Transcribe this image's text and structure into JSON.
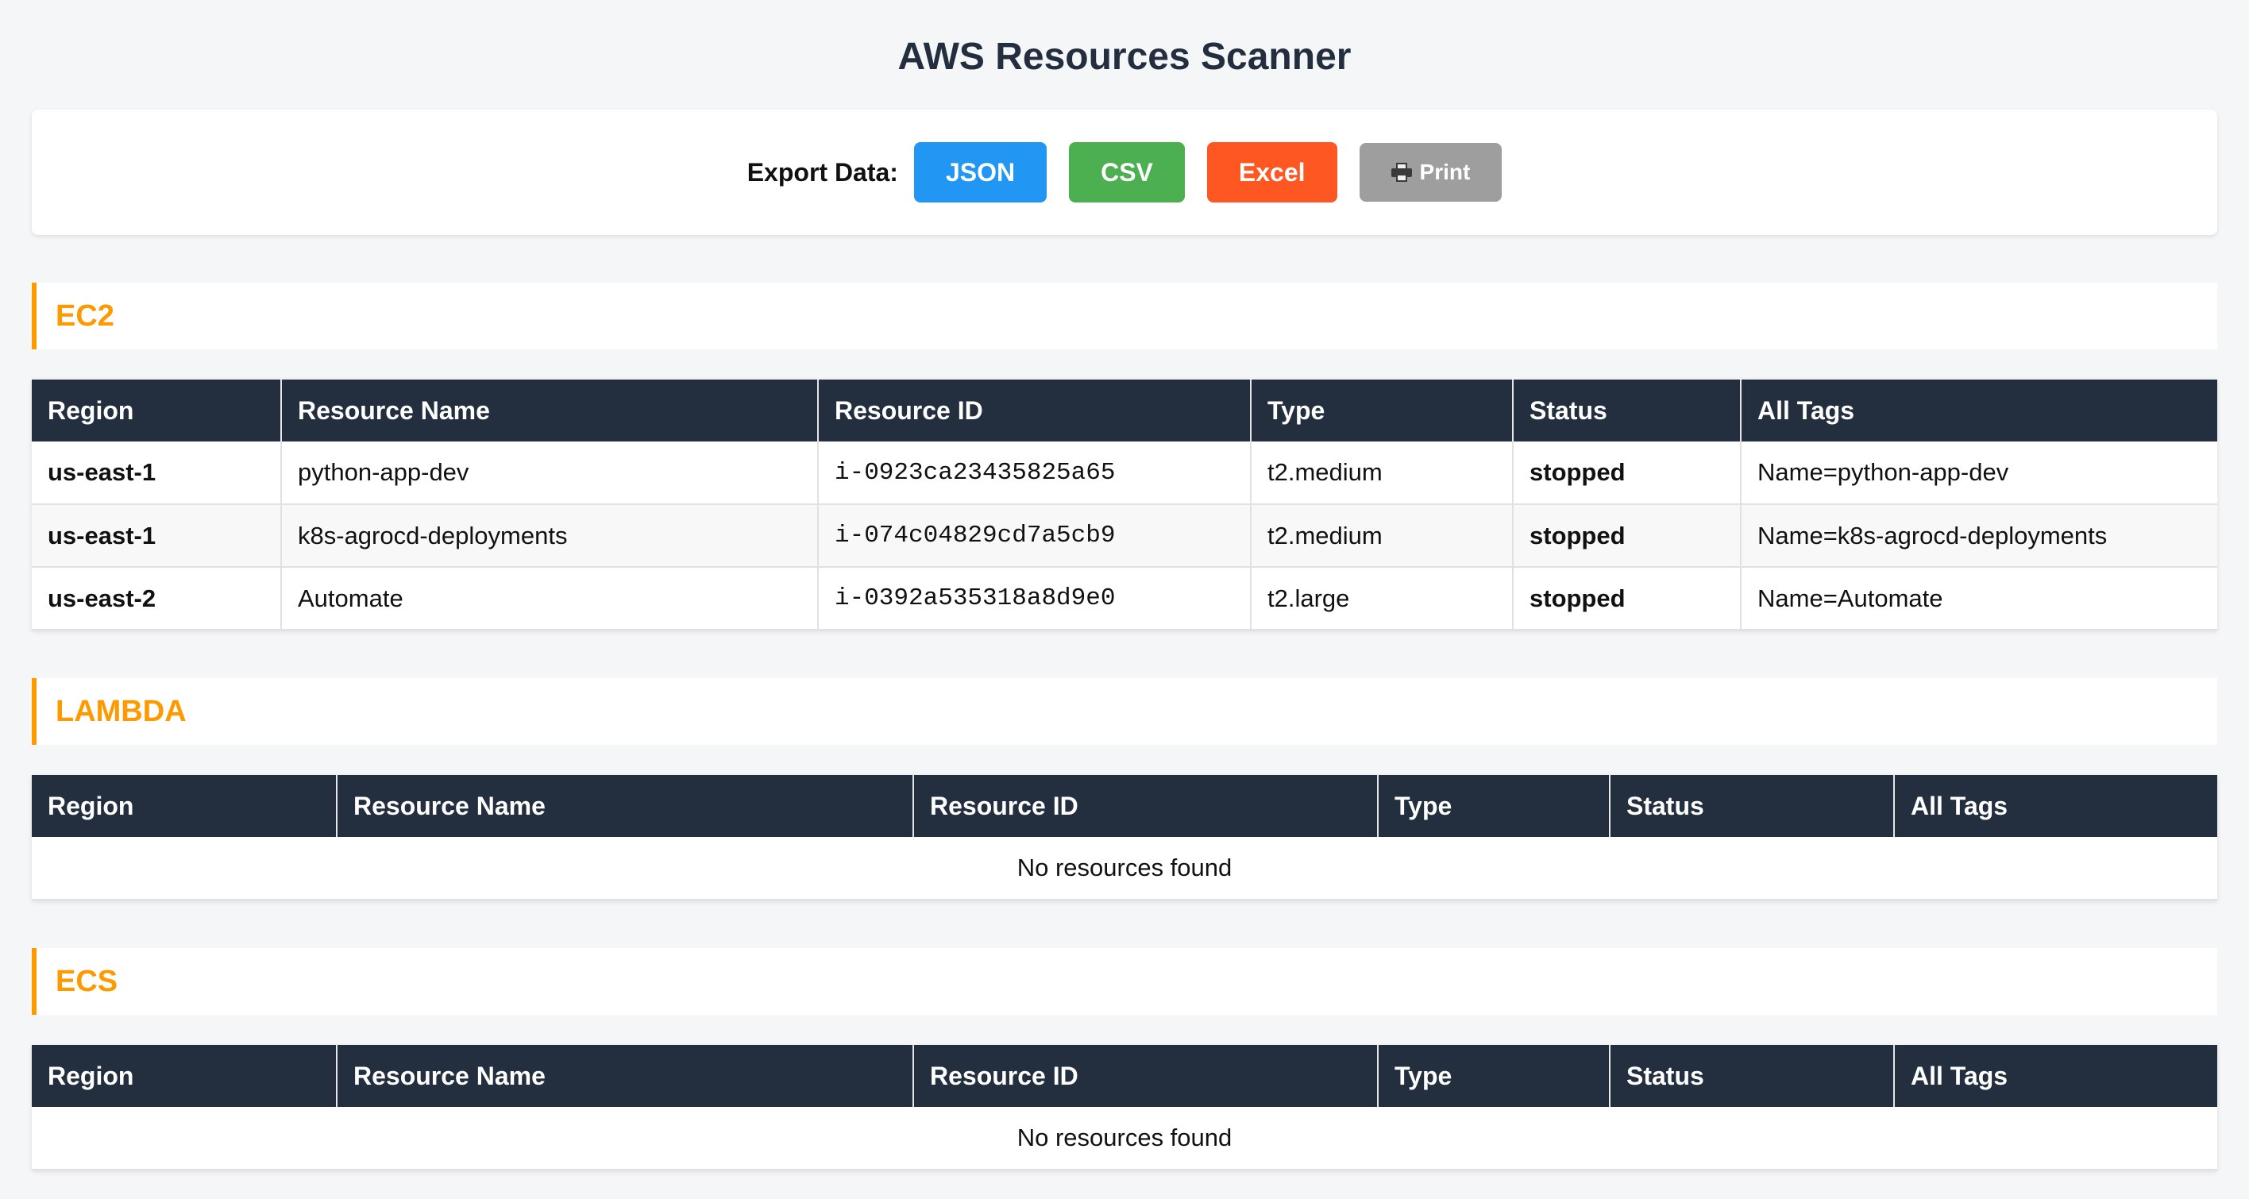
{
  "title": "AWS Resources Scanner",
  "export": {
    "label": "Export Data:",
    "json_label": "JSON",
    "csv_label": "CSV",
    "excel_label": "Excel",
    "print_label": "Print",
    "print_icon": "printer-icon"
  },
  "columns": [
    "Region",
    "Resource Name",
    "Resource ID",
    "Type",
    "Status",
    "All Tags"
  ],
  "sections": [
    {
      "name": "EC2",
      "rows": [
        {
          "region": "us-east-1",
          "name": "python-app-dev",
          "id": "i-0923ca23435825a65",
          "type": "t2.medium",
          "status": "stopped",
          "tags": "Name=python-app-dev"
        },
        {
          "region": "us-east-1",
          "name": "k8s-agrocd-deployments",
          "id": "i-074c04829cd7a5cb9",
          "type": "t2.medium",
          "status": "stopped",
          "tags": "Name=k8s-agrocd-deployments"
        },
        {
          "region": "us-east-2",
          "name": "Automate",
          "id": "i-0392a535318a8d9e0",
          "type": "t2.large",
          "status": "stopped",
          "tags": "Name=Automate"
        }
      ]
    },
    {
      "name": "LAMBDA",
      "empty_text": "No resources found"
    },
    {
      "name": "ECS",
      "empty_text": "No resources found"
    }
  ],
  "colors": {
    "header_bg": "#232f3e",
    "accent": "#ff9900",
    "json": "#2196f3",
    "csv": "#4caf50",
    "excel": "#ff5722",
    "print": "#9e9e9e",
    "status_stopped": "#e53935"
  }
}
